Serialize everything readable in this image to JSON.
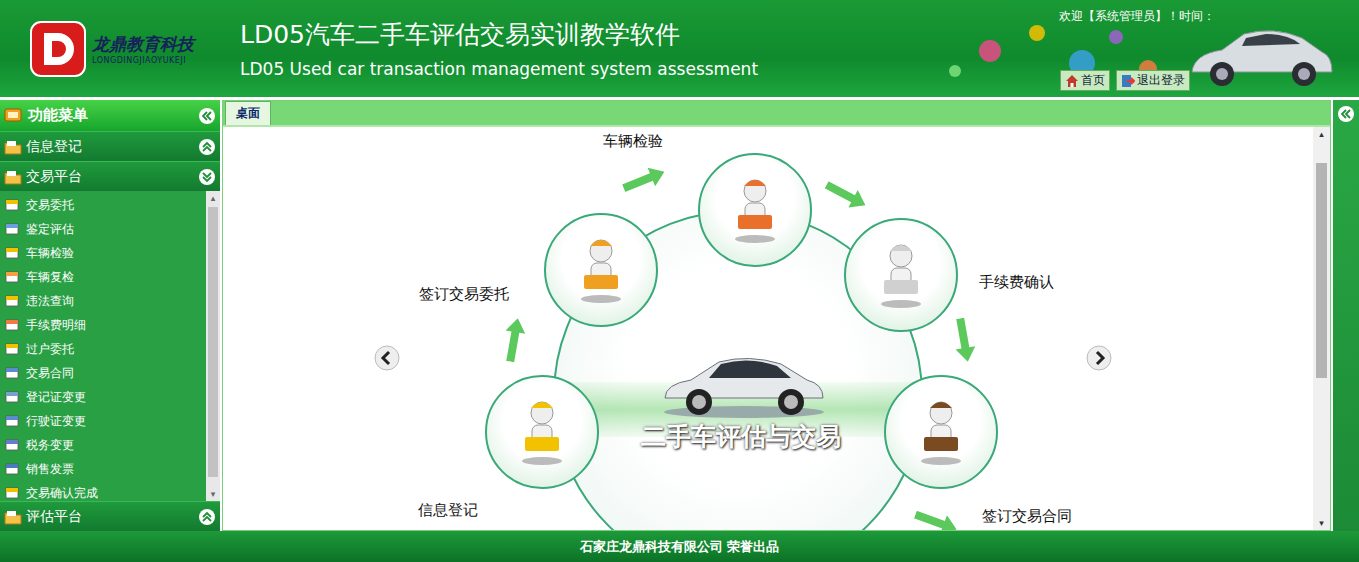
{
  "header": {
    "logo_text": "龙鼎教育科技",
    "logo_sub": "LONGDINGJIAOYUKEJI",
    "title": "LD05汽车二手车评估交易实训教学软件",
    "subtitle": "LD05 Used car transaction management system assessment",
    "welcome": "欢迎【系统管理员】！时间：",
    "buttons": [
      "首页",
      "退出登录"
    ]
  },
  "sidebar": {
    "title": "功能菜单",
    "sections": [
      {
        "label": "信息登记",
        "expanded": false,
        "items": []
      },
      {
        "label": "交易平台",
        "expanded": true,
        "items": [
          "交易委托",
          "鉴定评估",
          "车辆检验",
          "车辆复检",
          "违法查询",
          "手续费明细",
          "过户委托",
          "交易合同",
          "登记证变更",
          "行驶证变更",
          "税务变更",
          "销售发票",
          "交易确认完成"
        ]
      },
      {
        "label": "评估平台",
        "expanded": false,
        "items": []
      }
    ]
  },
  "tabs": [
    {
      "label": "桌面",
      "selected": true
    }
  ],
  "diagram": {
    "center": "二手车评估与交易",
    "steps": [
      {
        "label": "车辆检验"
      },
      {
        "label": "签订交易委托"
      },
      {
        "label": "手续费确认"
      },
      {
        "label": "信息登记"
      },
      {
        "label": "签订交易合同"
      }
    ]
  },
  "footer": "石家庄龙鼎科技有限公司 荣誉出品"
}
